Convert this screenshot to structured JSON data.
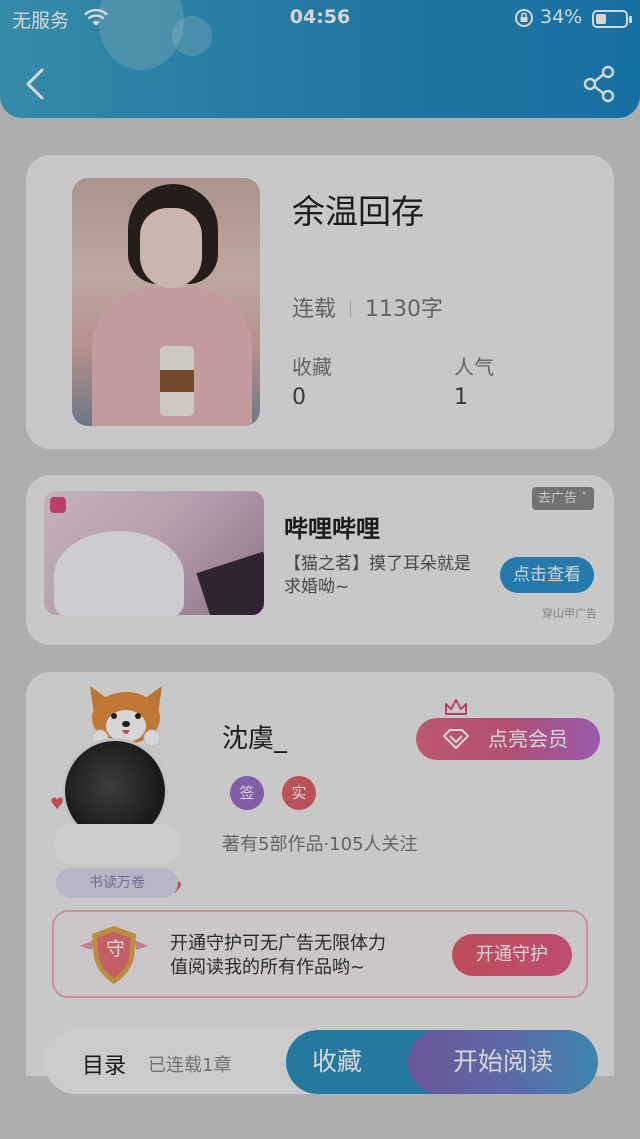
{
  "status_bar": {
    "carrier": "无服务",
    "time": "04:56",
    "battery_percent": "34%",
    "battery_level": 0.34
  },
  "header": {
    "back_icon": "chevron-left-icon",
    "share_icon": "share-icon"
  },
  "book": {
    "title": "余温回存",
    "status": "连载",
    "word_count": "1130字",
    "favorites_label": "收藏",
    "favorites_value": "0",
    "popularity_label": "人气",
    "popularity_value": "1"
  },
  "ad": {
    "title": "哔哩哔哩",
    "description": "【猫之茗】摸了耳朵就是求婚呦~",
    "close_label": "去广告 ˅",
    "action_label": "点击查看",
    "source": "穿山甲广告"
  },
  "author": {
    "name": "沈虞_",
    "tag_sign": "签",
    "tag_real": "实",
    "meta": "著有5部作品·105人关注",
    "vip_button": "点亮会员",
    "badge_label": "书读万卷",
    "guard_text_line1": "开通守护可无广告无限体力",
    "guard_text_line2": "值阅读我的所有作品哟~",
    "guard_button": "开通守护",
    "guard_shield_char": "守"
  },
  "bottom_bar": {
    "toc_label": "目录",
    "chapter_count": "已连载1章",
    "favorite_button": "收藏",
    "read_button": "开始阅读"
  },
  "colors": {
    "header_gradient_start": "#3fa6c8",
    "header_gradient_end": "#1b86c2",
    "ad_button": "#2b91cf",
    "vip_gradient": "#e06a82",
    "guard_button": "#e25c6a",
    "tag_sign": "#9a6fc6",
    "tag_real": "#e0626a"
  }
}
